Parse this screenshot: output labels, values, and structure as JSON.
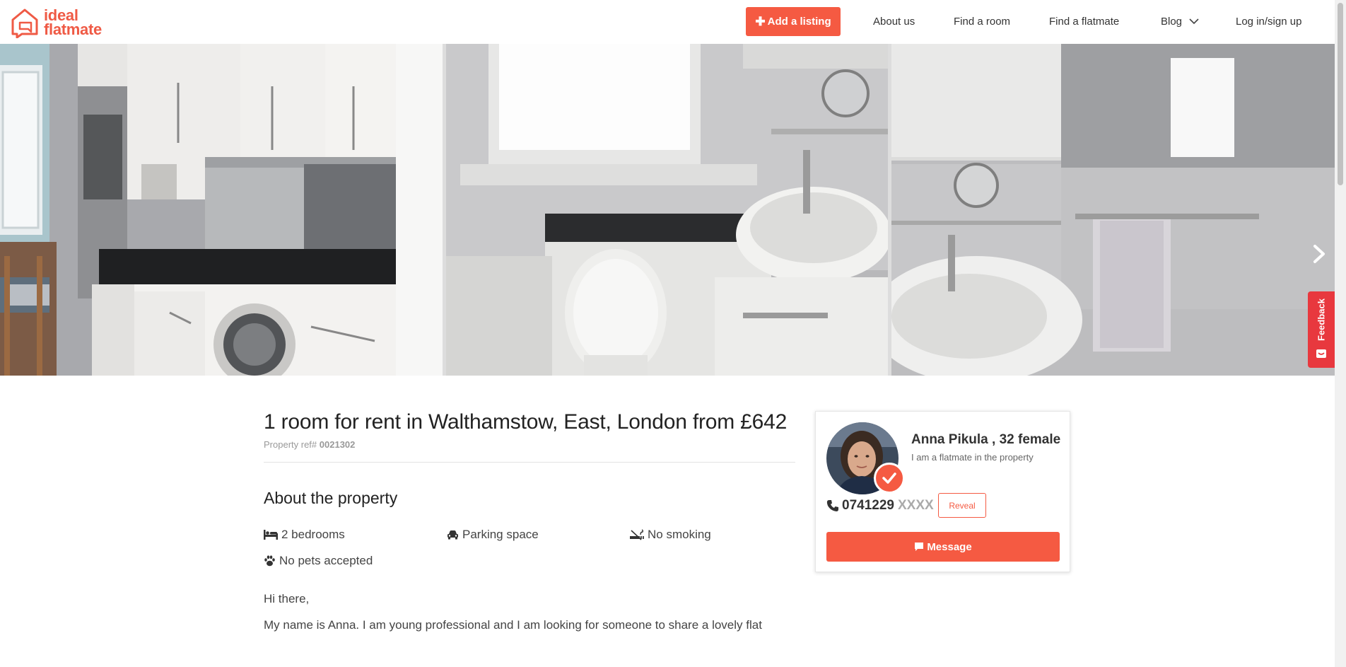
{
  "brand": {
    "line1": "ideal",
    "line2": "flatmate",
    "color": "#ef5a45"
  },
  "header": {
    "add_listing": "Add a listing",
    "nav": [
      "About us",
      "Find a room",
      "Find a flatmate",
      "Blog",
      "Log in/sign up"
    ]
  },
  "gallery": {
    "photos": [
      "kitchen",
      "bathroom-sink-toilet",
      "bathroom-sink-towel"
    ],
    "next_icon": "chevron-right-icon"
  },
  "feedback": {
    "label": "Feedback"
  },
  "listing": {
    "title": "1 room for rent in Walthamstow, East, London from £642",
    "ref_label": "Property ref#",
    "ref_number": "0021302",
    "about_heading": "About the property",
    "features": [
      {
        "icon": "bed-icon",
        "label": "2 bedrooms"
      },
      {
        "icon": "car-icon",
        "label": "Parking space"
      },
      {
        "icon": "no-smoking-icon",
        "label": "No smoking"
      },
      {
        "icon": "paw-icon",
        "label": "No pets accepted"
      }
    ],
    "description": [
      "Hi there,",
      "My name is Anna. I am young professional and I am looking for someone to share a lovely flat"
    ]
  },
  "contact": {
    "name": "Anna Pikula , 32 female",
    "role": "I am a flatmate in the property",
    "phone_visible": "0741229",
    "phone_masked": "XXXX",
    "reveal_label": "Reveal",
    "message_label": "Message",
    "verified_icon": "check-icon"
  },
  "colors": {
    "accent": "#f55a42",
    "feedback": "#e8383e"
  }
}
